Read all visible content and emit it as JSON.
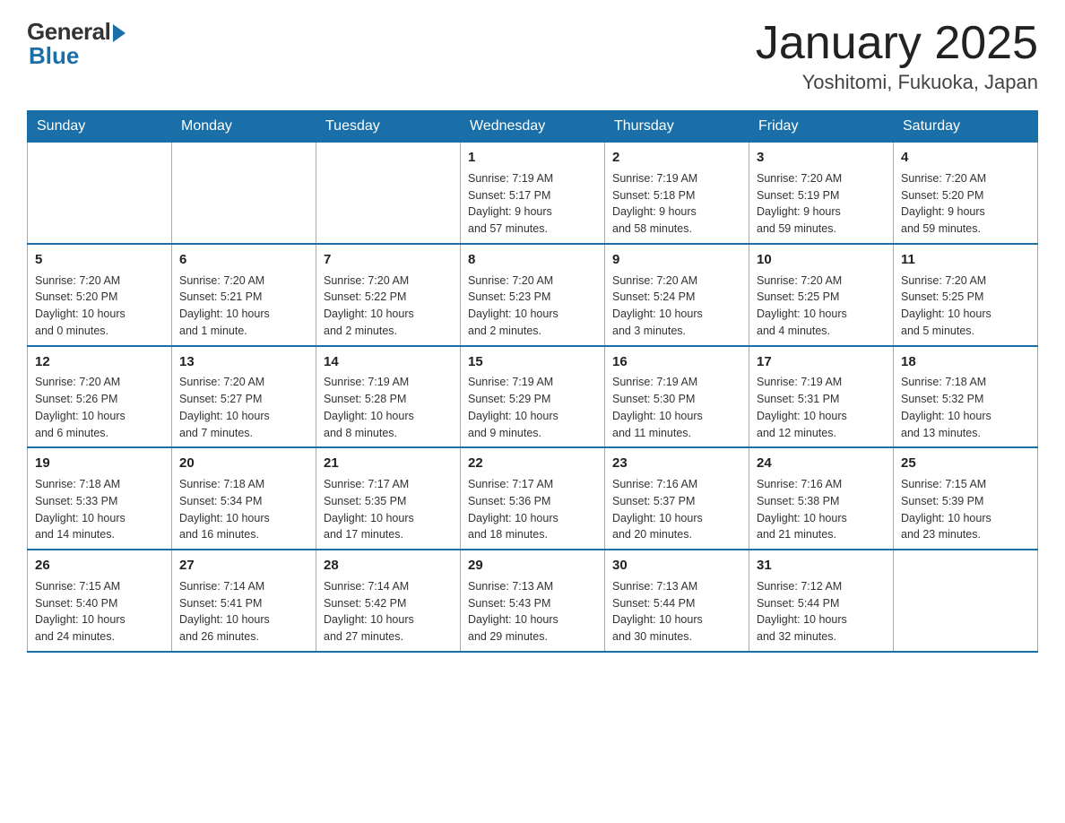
{
  "header": {
    "logo": {
      "general": "General",
      "blue": "Blue"
    },
    "title": "January 2025",
    "location": "Yoshitomi, Fukuoka, Japan"
  },
  "weekdays": [
    "Sunday",
    "Monday",
    "Tuesday",
    "Wednesday",
    "Thursday",
    "Friday",
    "Saturday"
  ],
  "weeks": [
    [
      {
        "day": "",
        "info": ""
      },
      {
        "day": "",
        "info": ""
      },
      {
        "day": "",
        "info": ""
      },
      {
        "day": "1",
        "info": "Sunrise: 7:19 AM\nSunset: 5:17 PM\nDaylight: 9 hours\nand 57 minutes."
      },
      {
        "day": "2",
        "info": "Sunrise: 7:19 AM\nSunset: 5:18 PM\nDaylight: 9 hours\nand 58 minutes."
      },
      {
        "day": "3",
        "info": "Sunrise: 7:20 AM\nSunset: 5:19 PM\nDaylight: 9 hours\nand 59 minutes."
      },
      {
        "day": "4",
        "info": "Sunrise: 7:20 AM\nSunset: 5:20 PM\nDaylight: 9 hours\nand 59 minutes."
      }
    ],
    [
      {
        "day": "5",
        "info": "Sunrise: 7:20 AM\nSunset: 5:20 PM\nDaylight: 10 hours\nand 0 minutes."
      },
      {
        "day": "6",
        "info": "Sunrise: 7:20 AM\nSunset: 5:21 PM\nDaylight: 10 hours\nand 1 minute."
      },
      {
        "day": "7",
        "info": "Sunrise: 7:20 AM\nSunset: 5:22 PM\nDaylight: 10 hours\nand 2 minutes."
      },
      {
        "day": "8",
        "info": "Sunrise: 7:20 AM\nSunset: 5:23 PM\nDaylight: 10 hours\nand 2 minutes."
      },
      {
        "day": "9",
        "info": "Sunrise: 7:20 AM\nSunset: 5:24 PM\nDaylight: 10 hours\nand 3 minutes."
      },
      {
        "day": "10",
        "info": "Sunrise: 7:20 AM\nSunset: 5:25 PM\nDaylight: 10 hours\nand 4 minutes."
      },
      {
        "day": "11",
        "info": "Sunrise: 7:20 AM\nSunset: 5:25 PM\nDaylight: 10 hours\nand 5 minutes."
      }
    ],
    [
      {
        "day": "12",
        "info": "Sunrise: 7:20 AM\nSunset: 5:26 PM\nDaylight: 10 hours\nand 6 minutes."
      },
      {
        "day": "13",
        "info": "Sunrise: 7:20 AM\nSunset: 5:27 PM\nDaylight: 10 hours\nand 7 minutes."
      },
      {
        "day": "14",
        "info": "Sunrise: 7:19 AM\nSunset: 5:28 PM\nDaylight: 10 hours\nand 8 minutes."
      },
      {
        "day": "15",
        "info": "Sunrise: 7:19 AM\nSunset: 5:29 PM\nDaylight: 10 hours\nand 9 minutes."
      },
      {
        "day": "16",
        "info": "Sunrise: 7:19 AM\nSunset: 5:30 PM\nDaylight: 10 hours\nand 11 minutes."
      },
      {
        "day": "17",
        "info": "Sunrise: 7:19 AM\nSunset: 5:31 PM\nDaylight: 10 hours\nand 12 minutes."
      },
      {
        "day": "18",
        "info": "Sunrise: 7:18 AM\nSunset: 5:32 PM\nDaylight: 10 hours\nand 13 minutes."
      }
    ],
    [
      {
        "day": "19",
        "info": "Sunrise: 7:18 AM\nSunset: 5:33 PM\nDaylight: 10 hours\nand 14 minutes."
      },
      {
        "day": "20",
        "info": "Sunrise: 7:18 AM\nSunset: 5:34 PM\nDaylight: 10 hours\nand 16 minutes."
      },
      {
        "day": "21",
        "info": "Sunrise: 7:17 AM\nSunset: 5:35 PM\nDaylight: 10 hours\nand 17 minutes."
      },
      {
        "day": "22",
        "info": "Sunrise: 7:17 AM\nSunset: 5:36 PM\nDaylight: 10 hours\nand 18 minutes."
      },
      {
        "day": "23",
        "info": "Sunrise: 7:16 AM\nSunset: 5:37 PM\nDaylight: 10 hours\nand 20 minutes."
      },
      {
        "day": "24",
        "info": "Sunrise: 7:16 AM\nSunset: 5:38 PM\nDaylight: 10 hours\nand 21 minutes."
      },
      {
        "day": "25",
        "info": "Sunrise: 7:15 AM\nSunset: 5:39 PM\nDaylight: 10 hours\nand 23 minutes."
      }
    ],
    [
      {
        "day": "26",
        "info": "Sunrise: 7:15 AM\nSunset: 5:40 PM\nDaylight: 10 hours\nand 24 minutes."
      },
      {
        "day": "27",
        "info": "Sunrise: 7:14 AM\nSunset: 5:41 PM\nDaylight: 10 hours\nand 26 minutes."
      },
      {
        "day": "28",
        "info": "Sunrise: 7:14 AM\nSunset: 5:42 PM\nDaylight: 10 hours\nand 27 minutes."
      },
      {
        "day": "29",
        "info": "Sunrise: 7:13 AM\nSunset: 5:43 PM\nDaylight: 10 hours\nand 29 minutes."
      },
      {
        "day": "30",
        "info": "Sunrise: 7:13 AM\nSunset: 5:44 PM\nDaylight: 10 hours\nand 30 minutes."
      },
      {
        "day": "31",
        "info": "Sunrise: 7:12 AM\nSunset: 5:44 PM\nDaylight: 10 hours\nand 32 minutes."
      },
      {
        "day": "",
        "info": ""
      }
    ]
  ]
}
